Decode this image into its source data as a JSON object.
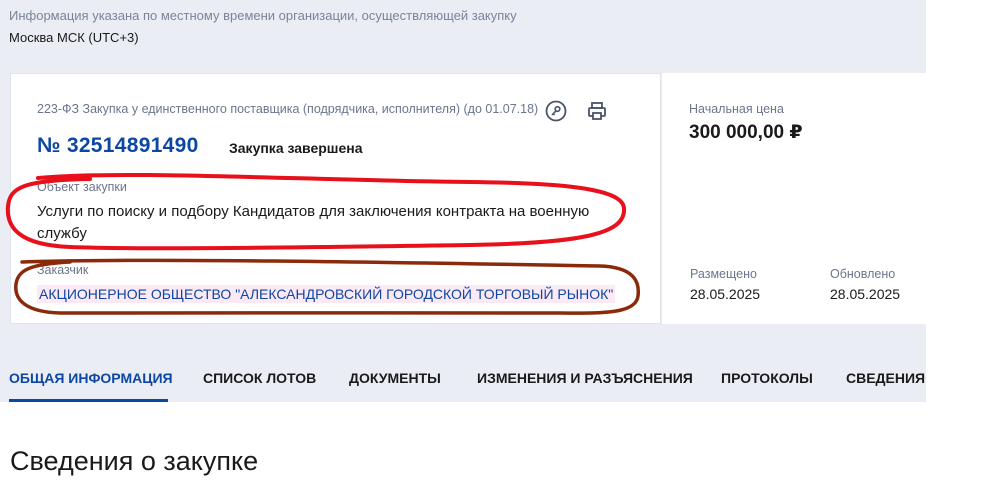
{
  "timezone": {
    "note": "Информация указана по местному времени организации, осуществляющей закупку",
    "value": "Москва МСК (UTC+3)"
  },
  "procurement": {
    "law_type": "223-ФЗ Закупка у единственного поставщика (подрядчика, исполнителя) (до 01.07.18)",
    "number": "№ 32514891490",
    "status": "Закупка завершена",
    "object_label": "Объект закупки",
    "object_text": "Услуги по поиску и подбору Кандидатов для заключения контракта на военную службу",
    "customer_label": "Заказчик",
    "customer_name": "АКЦИОНЕРНОЕ ОБЩЕСТВО \"АЛЕКСАНДРОВСКИЙ ГОРОДСКОЙ ТОРГОВЫЙ РЫНОК\""
  },
  "price": {
    "label": "Начальная цена",
    "value": "300 000,00 ₽"
  },
  "dates": {
    "posted_label": "Размещено",
    "posted_value": "28.05.2025",
    "updated_label": "Обновлено",
    "updated_value": "28.05.2025"
  },
  "tabs": [
    {
      "label": "Общая информация",
      "active": true
    },
    {
      "label": "Список лотов",
      "active": false
    },
    {
      "label": "Документы",
      "active": false
    },
    {
      "label": "Изменения и разъяснения",
      "active": false
    },
    {
      "label": "Протоколы",
      "active": false
    },
    {
      "label": "Сведения",
      "active": false
    }
  ],
  "section_title": "Сведения о закупке",
  "icons": {
    "key": "key-icon",
    "print": "printer-icon"
  },
  "colors": {
    "brand_blue": "#0d47a1",
    "background": "#eaedf3",
    "annotation_red": "#e8101a",
    "annotation_brown": "#8a2a0a"
  }
}
